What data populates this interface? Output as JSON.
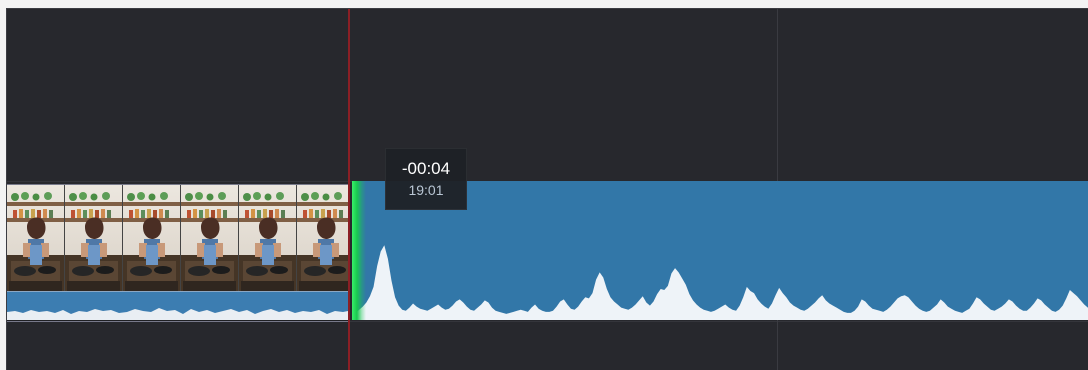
{
  "ui": {
    "background": "#27282d",
    "accent_blue": "#3277a8",
    "playhead_red": "#8c1f25",
    "handle_green": "#19c94f"
  },
  "tooltip": {
    "offset": "-00:04",
    "time": "19:01"
  },
  "video_clip": {
    "thumbnails": [
      "kitchen-cooking-thumbnail",
      "kitchen-cooking-thumbnail",
      "kitchen-cooking-thumbnail",
      "kitchen-cooking-thumbnail",
      "kitchen-cooking-thumbnail",
      "kitchen-cooking-thumbnail"
    ]
  },
  "audio_clip": {
    "waveform": [
      0.02,
      0.03,
      0.06,
      0.09,
      0.13,
      0.19,
      0.28,
      0.48,
      0.62,
      0.68,
      0.55,
      0.34,
      0.18,
      0.1,
      0.06,
      0.05,
      0.08,
      0.12,
      0.09,
      0.07,
      0.06,
      0.05,
      0.07,
      0.09,
      0.11,
      0.08,
      0.06,
      0.07,
      0.1,
      0.14,
      0.16,
      0.13,
      0.09,
      0.06,
      0.05,
      0.08,
      0.11,
      0.15,
      0.13,
      0.08,
      0.05,
      0.04,
      0.03,
      0.02,
      0.03,
      0.04,
      0.05,
      0.06,
      0.05,
      0.04,
      0.08,
      0.11,
      0.07,
      0.05,
      0.04,
      0.04,
      0.05,
      0.09,
      0.14,
      0.16,
      0.11,
      0.07,
      0.06,
      0.09,
      0.14,
      0.18,
      0.17,
      0.22,
      0.35,
      0.42,
      0.37,
      0.26,
      0.18,
      0.14,
      0.11,
      0.08,
      0.07,
      0.06,
      0.08,
      0.11,
      0.15,
      0.19,
      0.13,
      0.1,
      0.14,
      0.21,
      0.26,
      0.25,
      0.29,
      0.41,
      0.46,
      0.42,
      0.36,
      0.3,
      0.21,
      0.15,
      0.11,
      0.08,
      0.06,
      0.05,
      0.04,
      0.05,
      0.07,
      0.09,
      0.11,
      0.08,
      0.06,
      0.05,
      0.1,
      0.18,
      0.28,
      0.24,
      0.22,
      0.16,
      0.12,
      0.09,
      0.07,
      0.12,
      0.2,
      0.27,
      0.22,
      0.18,
      0.13,
      0.1,
      0.08,
      0.06,
      0.05,
      0.07,
      0.1,
      0.13,
      0.17,
      0.2,
      0.15,
      0.12,
      0.1,
      0.08,
      0.06,
      0.04,
      0.03,
      0.03,
      0.05,
      0.09,
      0.16,
      0.14,
      0.1,
      0.07,
      0.06,
      0.05,
      0.04,
      0.06,
      0.09,
      0.13,
      0.17,
      0.19,
      0.2,
      0.18,
      0.14,
      0.1,
      0.07,
      0.05,
      0.04,
      0.05,
      0.08,
      0.11,
      0.16,
      0.13,
      0.09,
      0.07,
      0.05,
      0.04,
      0.03,
      0.05,
      0.07,
      0.12,
      0.18,
      0.16,
      0.12,
      0.09,
      0.06,
      0.05,
      0.07,
      0.09,
      0.12,
      0.16,
      0.14,
      0.1,
      0.07,
      0.05,
      0.05,
      0.08,
      0.12,
      0.17,
      0.15,
      0.11,
      0.08,
      0.05,
      0.04,
      0.06,
      0.1,
      0.17,
      0.25,
      0.22,
      0.19,
      0.15,
      0.11,
      0.08,
      0.05,
      0.03
    ]
  }
}
